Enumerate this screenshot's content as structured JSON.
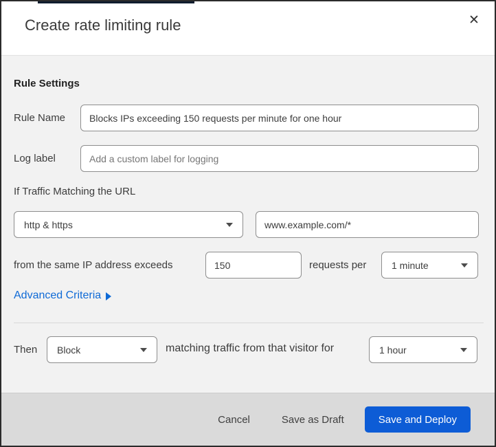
{
  "modal": {
    "title": "Create rate limiting rule"
  },
  "icons": {
    "close": "✕"
  },
  "form": {
    "section_heading": "Rule Settings",
    "rule_name": {
      "label": "Rule Name",
      "value": "Blocks IPs exceeding 150 requests per minute for one hour"
    },
    "log_label": {
      "label": "Log label",
      "placeholder": "Add a custom label for logging"
    },
    "traffic_match": {
      "intro": "If Traffic Matching the URL",
      "scheme_selected": "http & https",
      "url_value": "www.example.com/*",
      "threshold_prefix": "from the same IP address exceeds",
      "threshold_value": "150",
      "threshold_suffix": "requests per",
      "period_selected": "1 minute"
    },
    "advanced_link_label": "Advanced Criteria",
    "then": {
      "label": "Then",
      "action_selected": "Block",
      "middle_text": "matching traffic from that visitor for",
      "duration_selected": "1 hour"
    }
  },
  "footer": {
    "cancel_label": "Cancel",
    "save_draft_label": "Save as Draft",
    "save_deploy_label": "Save and Deploy"
  },
  "colors": {
    "primary_blue": "#0d5cd6",
    "link_blue": "#0f6ad6",
    "header_bg": "#ffffff",
    "body_bg": "#f2f2f2",
    "footer_bg": "#dadada",
    "input_border": "#8d8d8d",
    "window_border": "#2b2b2b"
  }
}
